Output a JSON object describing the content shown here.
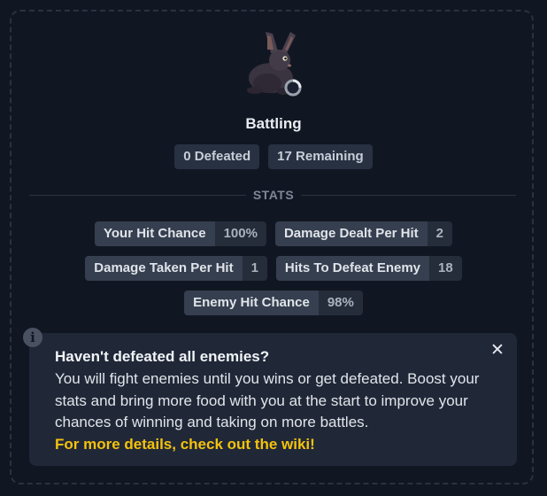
{
  "status": {
    "title": "Battling"
  },
  "badges": {
    "defeated": "0 Defeated",
    "remaining": "17 Remaining"
  },
  "stats_heading": "STATS",
  "stats": {
    "hit_chance": {
      "label": "Your Hit Chance",
      "value": "100%"
    },
    "damage_dealt": {
      "label": "Damage Dealt Per Hit",
      "value": "2"
    },
    "damage_taken": {
      "label": "Damage Taken Per Hit",
      "value": "1"
    },
    "hits_to_defeat": {
      "label": "Hits To Defeat Enemy",
      "value": "18"
    },
    "enemy_hit_chance": {
      "label": "Enemy Hit Chance",
      "value": "98%"
    }
  },
  "info": {
    "title": "Haven't defeated all enemies?",
    "body": "You will fight enemies until you wins or get defeated. Boost your stats and bring more food with you at the start to improve your chances of winning and taking on more battles.",
    "link": "For more details, check out the wiki!",
    "close_glyph": "✕",
    "icon_glyph": "i"
  },
  "icons": {
    "avatar": "rabbit-icon",
    "spinner": "loading-spinner-icon",
    "info": "info-icon",
    "close": "close-icon"
  }
}
